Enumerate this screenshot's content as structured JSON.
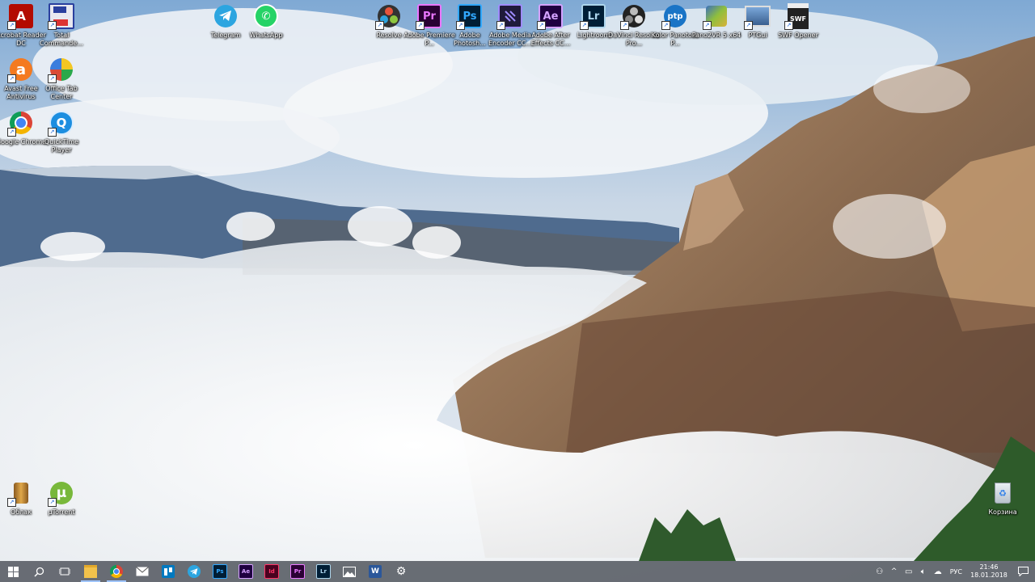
{
  "desktop": {
    "icons": [
      {
        "label": "Acrobat Reader DC",
        "icon": "acrobat-icon"
      },
      {
        "label": "Total Commande...",
        "icon": "total-commander-icon"
      },
      {
        "label": "Avast Free Antivirus",
        "icon": "avast-icon"
      },
      {
        "label": "Office Tab Center",
        "icon": "office-tab-icon"
      },
      {
        "label": "Google Chrome",
        "icon": "chrome-icon"
      },
      {
        "label": "QuickTime Player",
        "icon": "quicktime-icon"
      },
      {
        "label": "Telegram",
        "icon": "telegram-icon"
      },
      {
        "label": "WhatsApp",
        "icon": "whatsapp-icon"
      },
      {
        "label": "Resolve",
        "icon": "resolve-icon"
      },
      {
        "label": "Adobe Premiere P...",
        "icon": "premiere-icon",
        "glyph": "Pr"
      },
      {
        "label": "Adobe Photosh...",
        "icon": "photoshop-icon",
        "glyph": "Ps"
      },
      {
        "label": "Adobe Media Encoder CC...",
        "icon": "media-encoder-icon"
      },
      {
        "label": "Adobe After Effects CC...",
        "icon": "after-effects-icon",
        "glyph": "Ae"
      },
      {
        "label": "Lightroom",
        "icon": "lightroom-icon",
        "glyph": "Lr"
      },
      {
        "label": "DaVinci Resolve Pro...",
        "icon": "davinci-icon"
      },
      {
        "label": "Kolor Panotour P...",
        "icon": "panotour-icon",
        "glyph": "ptp"
      },
      {
        "label": "Pano2VR 5 x64",
        "icon": "pano2vr-icon"
      },
      {
        "label": "PTGui",
        "icon": "ptgui-icon"
      },
      {
        "label": "SWF Opener",
        "icon": "swf-opener-icon",
        "glyph": "SWF"
      },
      {
        "label": "Облак",
        "icon": "oblak-icon"
      },
      {
        "label": "µTorrent",
        "icon": "utorrent-icon"
      },
      {
        "label": "Корзина",
        "icon": "recycle-bin-icon"
      }
    ]
  },
  "taskbar": {
    "items": [
      {
        "name": "start-icon"
      },
      {
        "name": "search-icon"
      },
      {
        "name": "task-view-icon"
      },
      {
        "name": "file-explorer-icon"
      },
      {
        "name": "chrome-icon"
      },
      {
        "name": "mail-icon"
      },
      {
        "name": "trello-icon"
      },
      {
        "name": "telegram-icon"
      },
      {
        "name": "photoshop-icon",
        "glyph": "Ps"
      },
      {
        "name": "after-effects-icon",
        "glyph": "Ae"
      },
      {
        "name": "indesign-icon",
        "glyph": "Id"
      },
      {
        "name": "premiere-icon",
        "glyph": "Pr"
      },
      {
        "name": "lightroom-icon",
        "glyph": "Lr"
      },
      {
        "name": "photos-icon"
      },
      {
        "name": "word-icon",
        "glyph": "W"
      },
      {
        "name": "settings-icon"
      }
    ],
    "tray": {
      "language": "РУС",
      "time": "21:46",
      "date": "18.01.2018"
    }
  }
}
